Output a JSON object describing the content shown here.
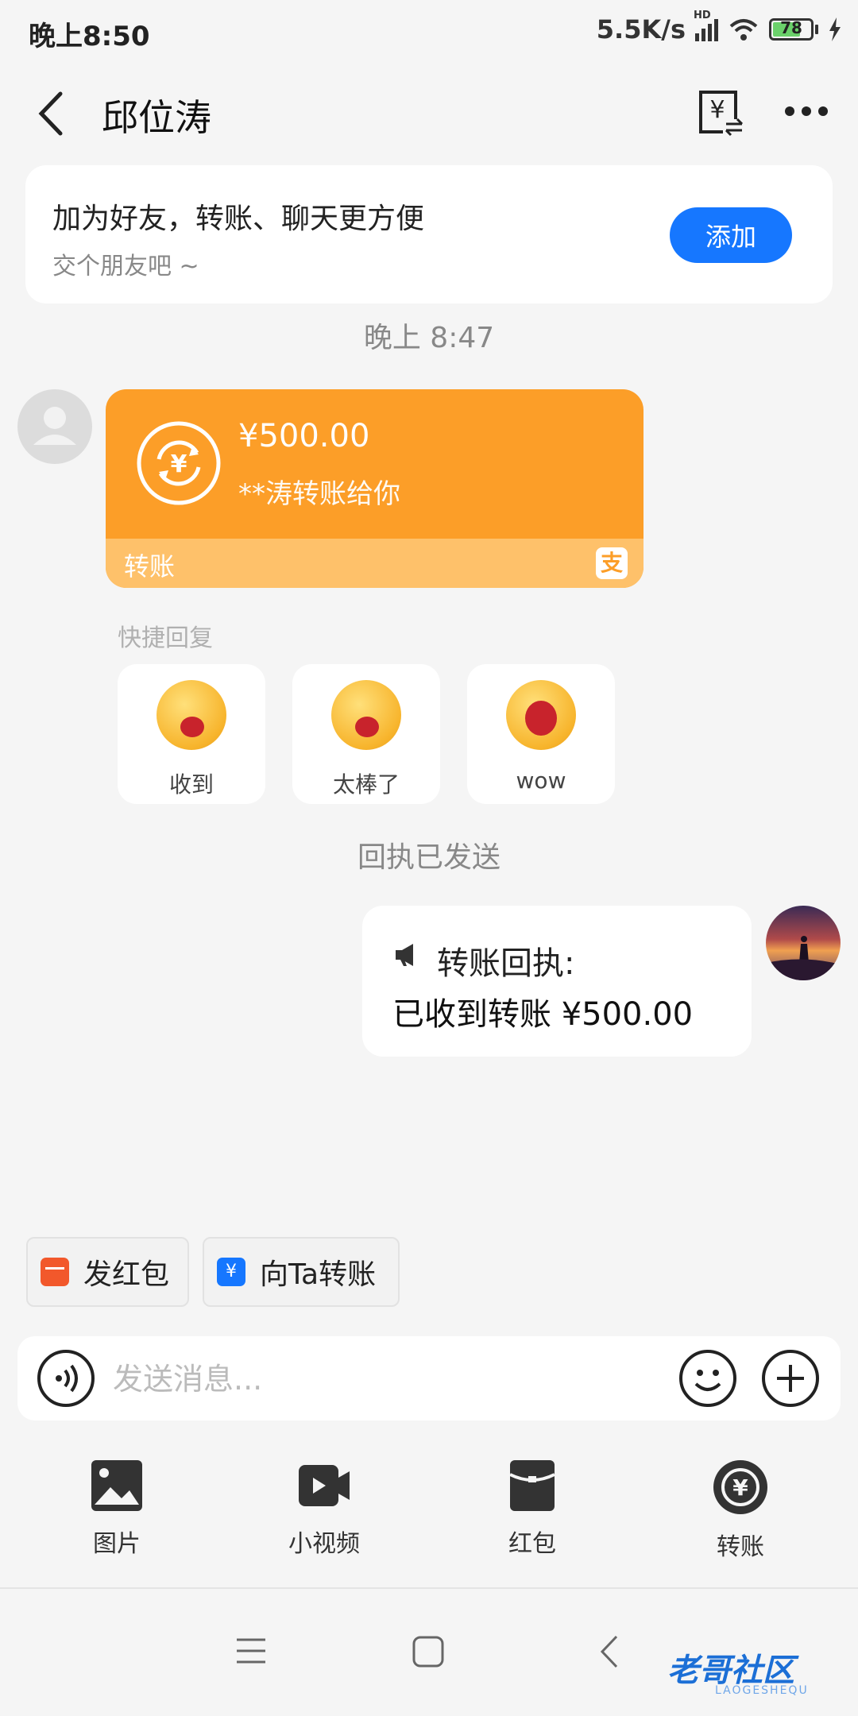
{
  "status_bar": {
    "time": "晚上8:50",
    "network_speed": "5.5K/s",
    "network_type": "HD",
    "battery": "78",
    "battery_level": 0.78
  },
  "header": {
    "title": "邱位涛",
    "back_icon": "chevron-left-icon",
    "bill_icon": "yuan-bill-icon",
    "more_icon": "more-dots-icon"
  },
  "friend_card": {
    "title": "加为好友，转账、聊天更方便",
    "subtitle": "交个朋友吧 ~",
    "add_label": "添加"
  },
  "chat": {
    "time_label": "晚上 8:47",
    "incoming_transfer": {
      "amount": "¥500.00",
      "description": "**涛转账给你",
      "footer": "转账",
      "brand_glyph": "支"
    },
    "quick_reply": {
      "label": "快捷回复",
      "options": [
        "收到",
        "太棒了",
        "wow"
      ]
    },
    "receipt_status": "回执已发送",
    "outgoing_receipt": {
      "title": "转账回执:",
      "body": "已收到转账 ¥500.00"
    }
  },
  "actions": {
    "red_packet": "发红包",
    "transfer_to": "向Ta转账"
  },
  "input": {
    "placeholder": "发送消息..."
  },
  "tools": [
    "图片",
    "小视频",
    "红包",
    "转账"
  ],
  "watermark": {
    "text": "老哥社区",
    "sub": "LAOGESHEQU"
  },
  "colors": {
    "accent": "#1677ff",
    "transfer_orange": "#fc9e28",
    "transfer_orange_light": "#fec16a"
  }
}
